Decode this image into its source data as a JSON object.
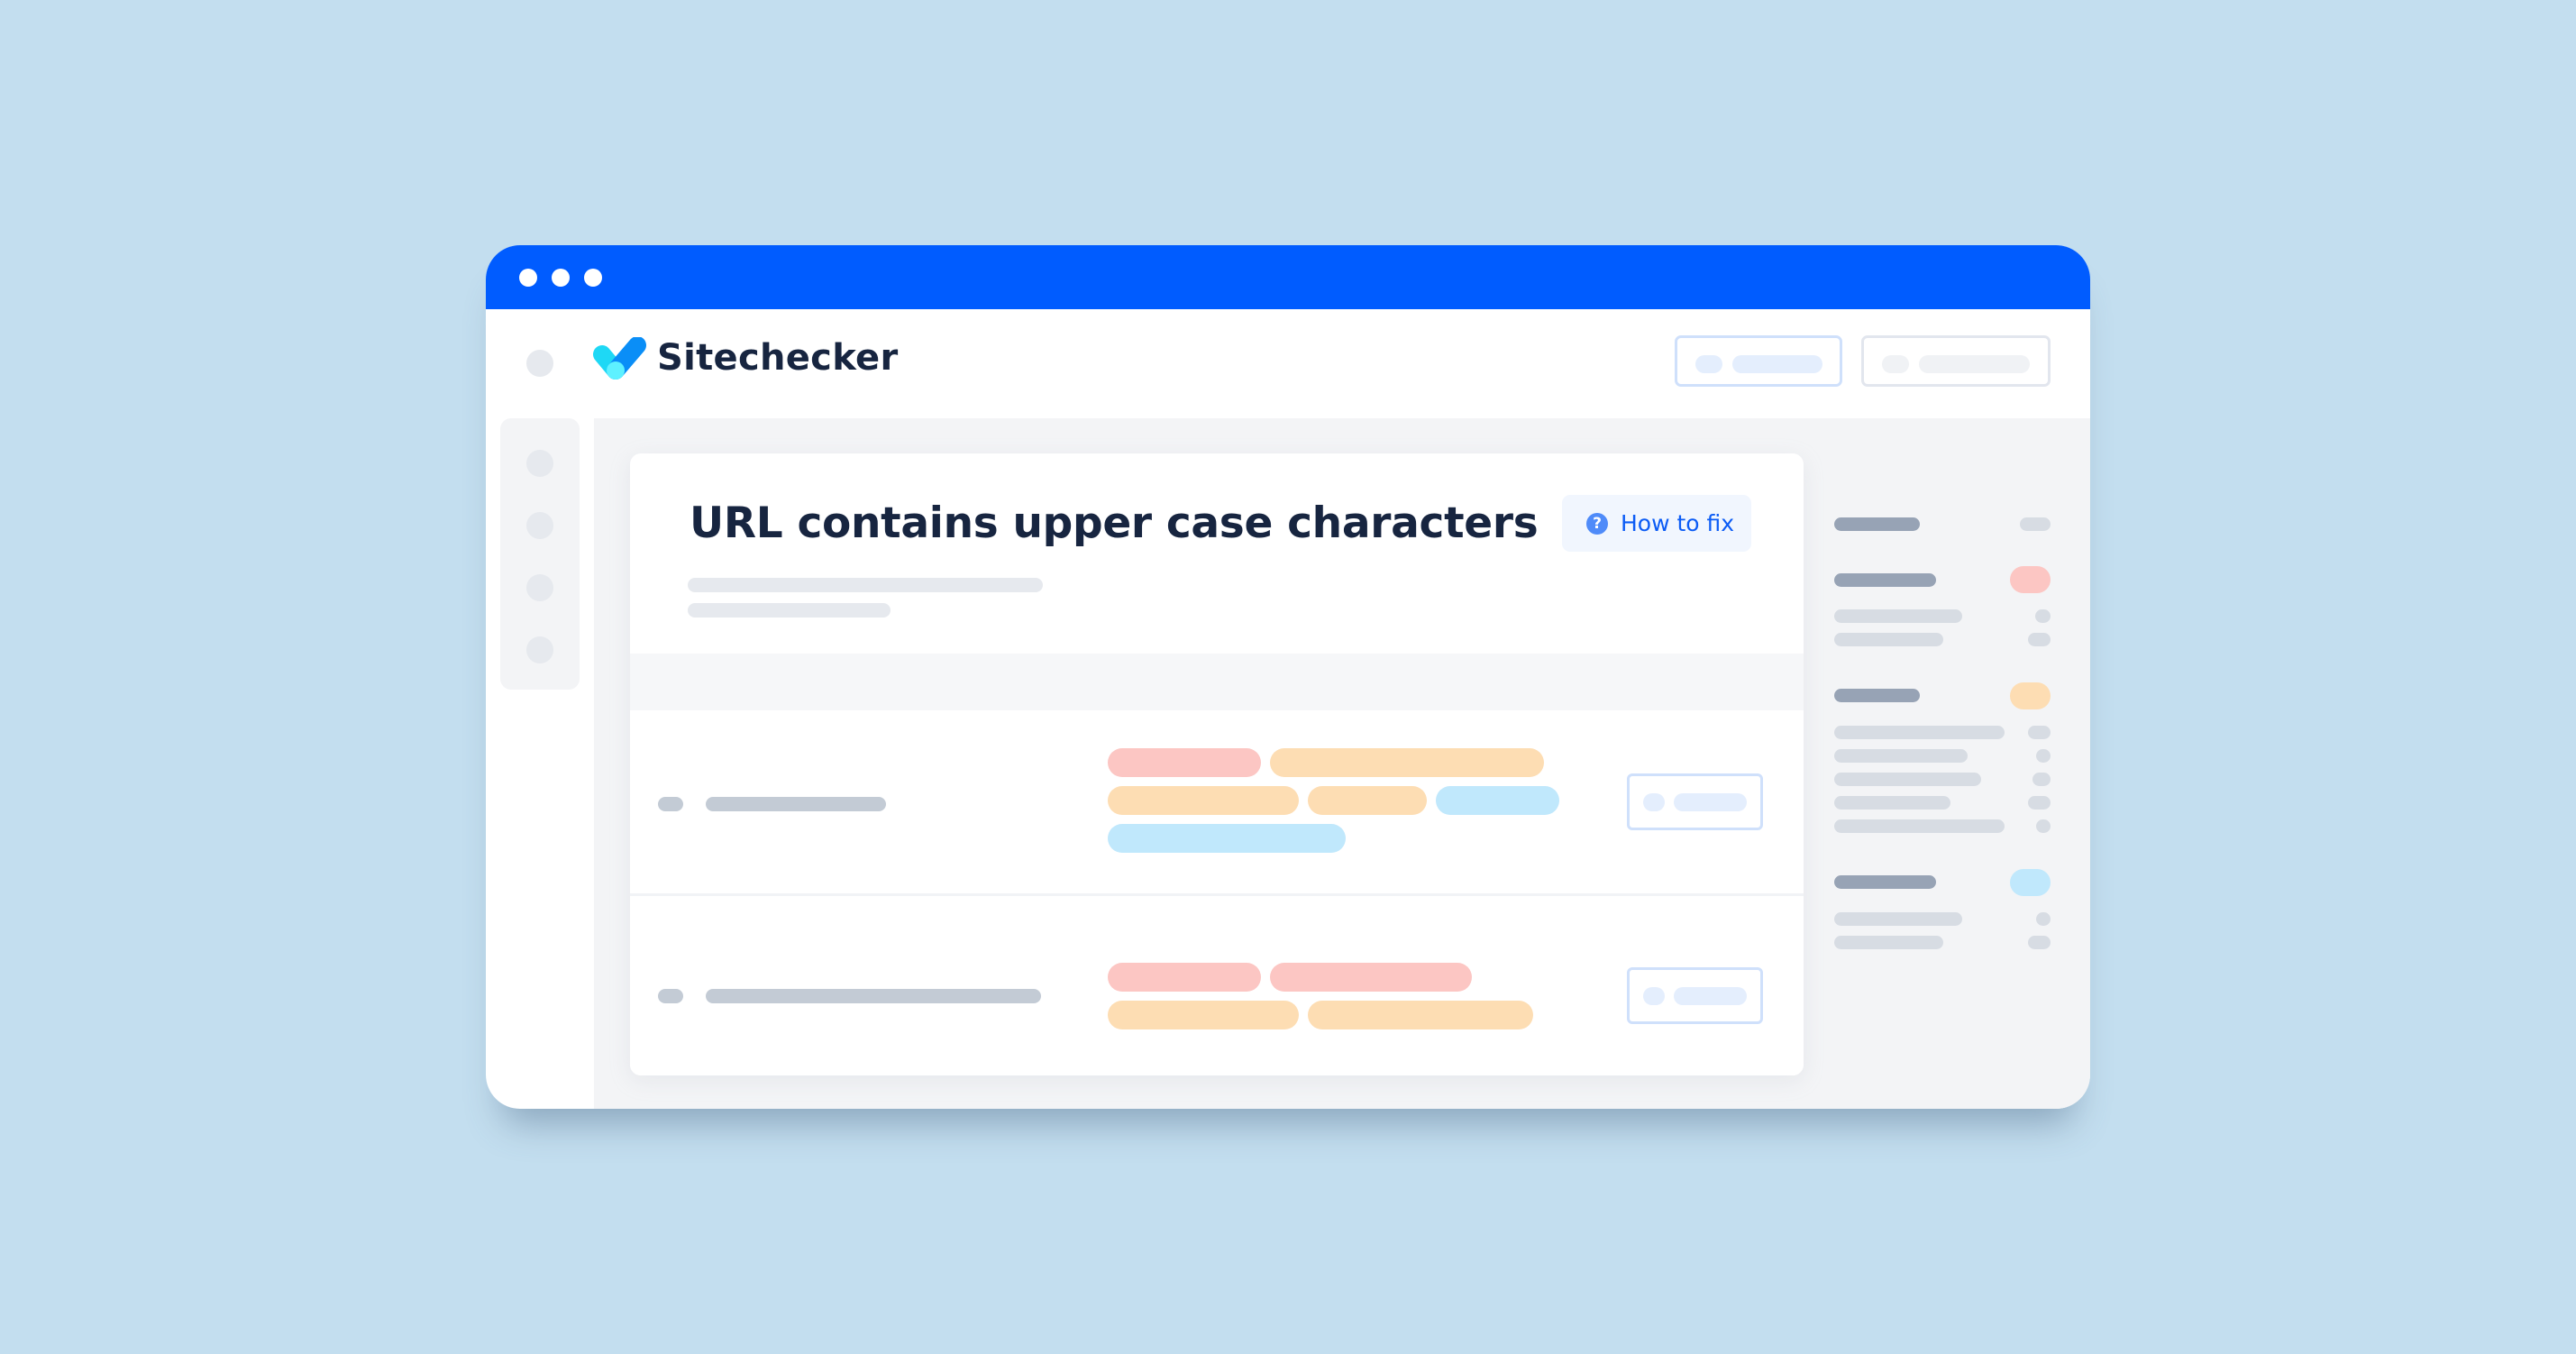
{
  "window": {
    "titlebar_color": "#005CFF",
    "window_controls": [
      "dot",
      "dot",
      "dot"
    ]
  },
  "header": {
    "brand": "Sitechecker",
    "logo_icon": "sitechecker-checkmark-logo",
    "buttons": [
      {
        "name": "primary-placeholder-button",
        "style": "blue"
      },
      {
        "name": "secondary-placeholder-button",
        "style": "gray"
      }
    ]
  },
  "sidebar": {
    "items": [
      "nav-item-1",
      "nav-item-2",
      "nav-item-3",
      "nav-item-4"
    ]
  },
  "issue_card": {
    "title": "URL contains upper case characters",
    "how_to_fix": {
      "label": "How to fix",
      "icon": "question-circle-icon",
      "icon_glyph": "?"
    },
    "rows": [
      {
        "tag_lines": [
          [
            "pink",
            "orange"
          ],
          [
            "orange",
            "orange",
            "blue"
          ],
          [
            "blue"
          ]
        ]
      },
      {
        "tag_lines": [
          [
            "pink",
            "pink"
          ],
          [
            "orange",
            "orange"
          ]
        ]
      }
    ]
  },
  "right_panel": {
    "groups": [
      {
        "badge_color": "gray",
        "lines": 0
      },
      {
        "badge_color": "#FCC6C3",
        "lines": 2
      },
      {
        "badge_color": "#FDDDB3",
        "lines": 5
      },
      {
        "badge_color": "#C0E8FC",
        "lines": 2
      }
    ]
  },
  "colors": {
    "background": "#C3DEEF",
    "accent": "#005CFF",
    "tag_pink": "#FCC6C3",
    "tag_orange": "#FDDDB3",
    "tag_blue": "#C0E8FC",
    "title_text": "#172540",
    "link_blue": "#0C5CF5"
  }
}
